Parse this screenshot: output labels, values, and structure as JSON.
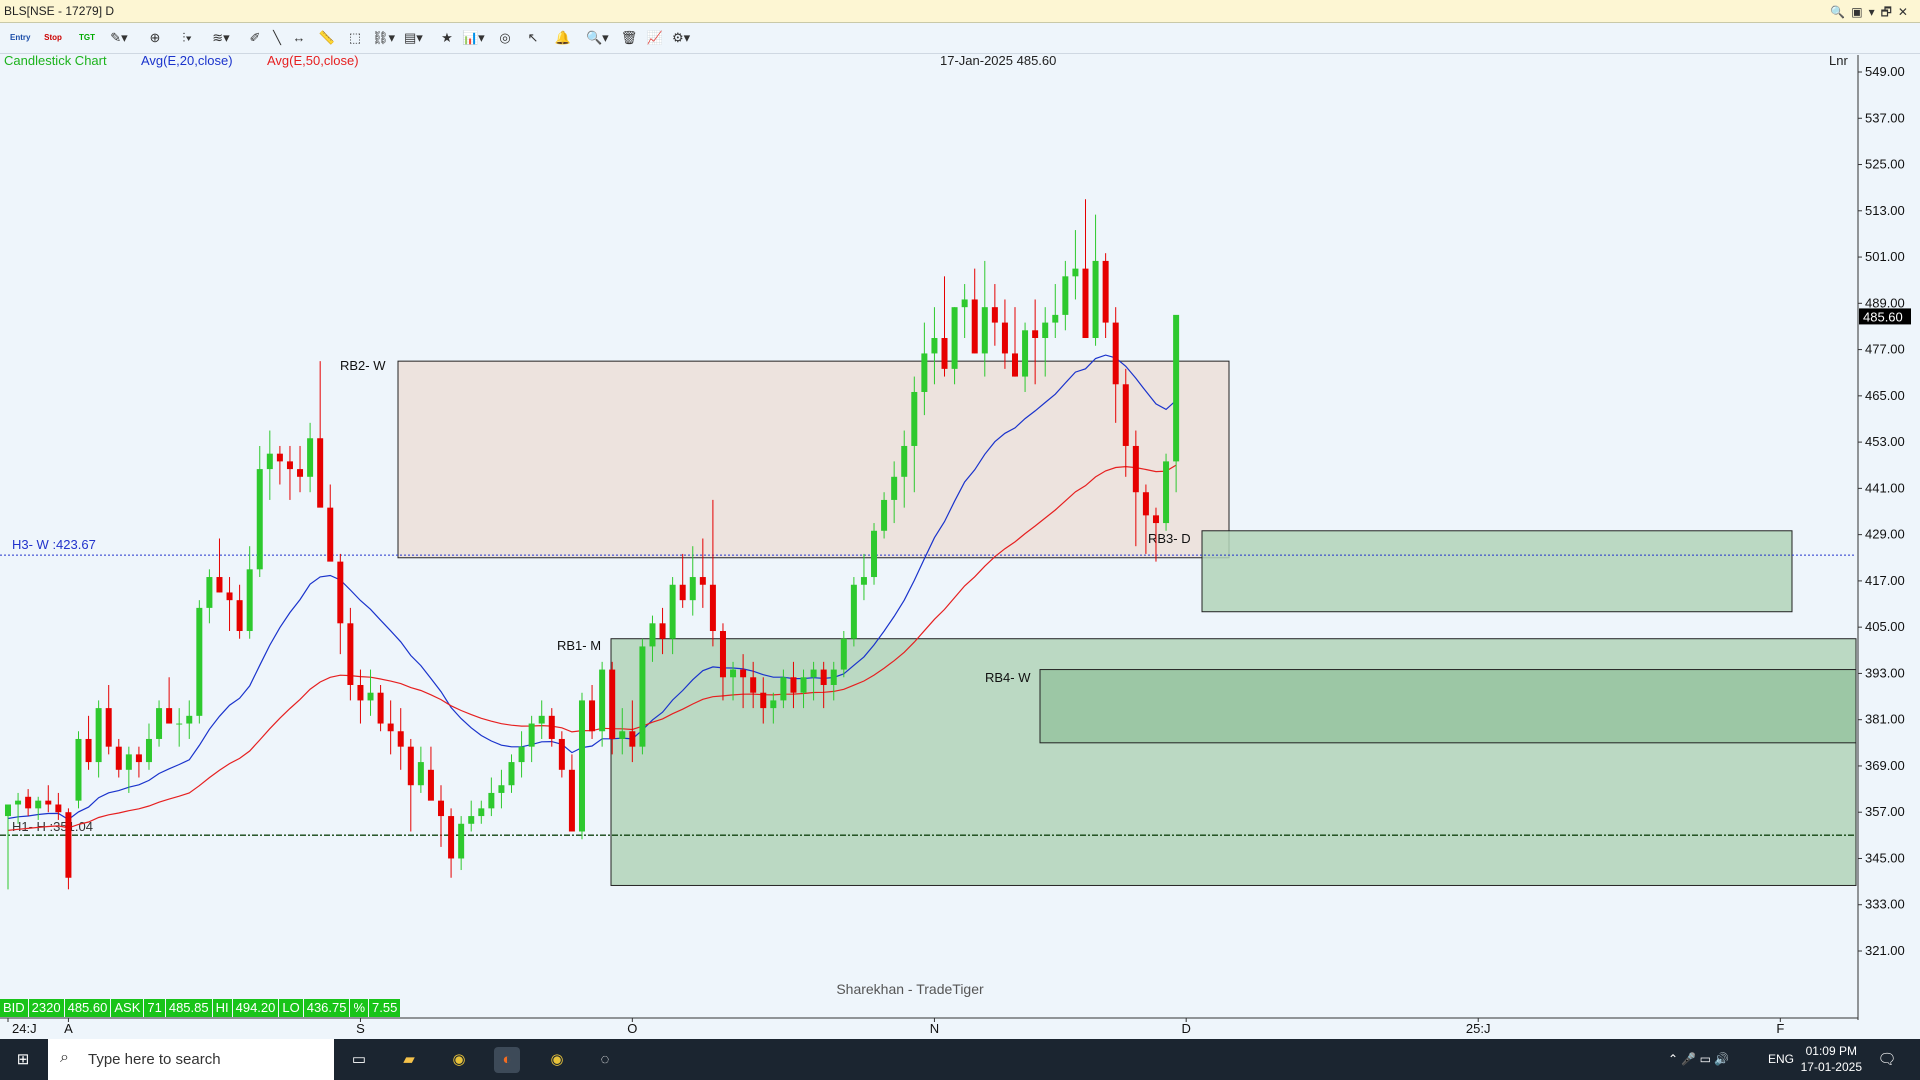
{
  "window": {
    "title": "BLS[NSE - 17279] D"
  },
  "toolbar": {
    "icons": [
      "entry-icon",
      "stop-icon",
      "target-icon",
      "draw-icon",
      "crosshair-icon",
      "line-tools-icon",
      "fib-icon",
      "pen-icon",
      "trendline-icon",
      "ray-icon",
      "ruler-icon",
      "box-icon",
      "link-icon",
      "template-icon",
      "favorite-icon",
      "indicator-icon",
      "scan-icon",
      "cursor-icon",
      "alert-icon",
      "zoom-icon",
      "delete-icon",
      "study-icon",
      "settings-icon"
    ],
    "entry_label": "Entry",
    "stop_label": "Stop",
    "tgt_label": "TGT"
  },
  "legend": {
    "chart_type": "Candlestick Chart",
    "avg20": "Avg(E,20,close)",
    "avg50": "Avg(E,50,close)",
    "center": "17-Jan-2025 485.60",
    "scale": "Lnr"
  },
  "colors": {
    "up": "#2ec92e",
    "down": "#e60000",
    "ema20": "#1a33cc",
    "ema50": "#e62020",
    "zone_red": "#ecdfd8",
    "zone_green": "#b2d3b8",
    "hline_blue": "#2233cc"
  },
  "chart_data": {
    "type": "candlestick",
    "ylim": [
      315,
      555
    ],
    "y_ticks": [
      "549.00",
      "537.00",
      "525.00",
      "513.00",
      "501.00",
      "489.00",
      "477.00",
      "465.00",
      "453.00",
      "441.00",
      "429.00",
      "417.00",
      "405.00",
      "393.00",
      "381.00",
      "369.00",
      "357.00",
      "345.00",
      "333.00",
      "321.00"
    ],
    "last_price_label": "485.60",
    "x_ticks": [
      {
        "label": "24:J",
        "i": 0
      },
      {
        "label": "A",
        "i": 6
      },
      {
        "label": "S",
        "i": 35
      },
      {
        "label": "O",
        "i": 62
      },
      {
        "label": "N",
        "i": 92
      },
      {
        "label": "D",
        "i": 117
      },
      {
        "label": "25:J",
        "i": 146
      },
      {
        "label": "F",
        "i": 176
      }
    ],
    "candles": [
      [
        356,
        359,
        337,
        359
      ],
      [
        359,
        362,
        354,
        360
      ],
      [
        361,
        363,
        356,
        358
      ],
      [
        358,
        361,
        355,
        360
      ],
      [
        360,
        364,
        357,
        359
      ],
      [
        359,
        362,
        355,
        357
      ],
      [
        357,
        358,
        337,
        340
      ],
      [
        360,
        378,
        358,
        376
      ],
      [
        376,
        382,
        368,
        370
      ],
      [
        370,
        386,
        366,
        384
      ],
      [
        384,
        390,
        372,
        374
      ],
      [
        374,
        376,
        366,
        368
      ],
      [
        368,
        374,
        362,
        372
      ],
      [
        372,
        374,
        366,
        370
      ],
      [
        370,
        380,
        368,
        376
      ],
      [
        376,
        386,
        374,
        384
      ],
      [
        384,
        392,
        380,
        380
      ],
      [
        380,
        384,
        374,
        380
      ],
      [
        380,
        386,
        376,
        382
      ],
      [
        382,
        412,
        380,
        410
      ],
      [
        410,
        420,
        406,
        418
      ],
      [
        418,
        428,
        414,
        414
      ],
      [
        414,
        418,
        404,
        412
      ],
      [
        412,
        416,
        402,
        404
      ],
      [
        404,
        426,
        402,
        420
      ],
      [
        420,
        452,
        418,
        446
      ],
      [
        446,
        456,
        438,
        450
      ],
      [
        450,
        452,
        442,
        448
      ],
      [
        448,
        452,
        438,
        446
      ],
      [
        446,
        452,
        440,
        444
      ],
      [
        444,
        458,
        440,
        454
      ],
      [
        454,
        474,
        446,
        436
      ],
      [
        436,
        442,
        424,
        422
      ],
      [
        422,
        424,
        398,
        406
      ],
      [
        406,
        410,
        386,
        390
      ],
      [
        390,
        394,
        380,
        386
      ],
      [
        386,
        394,
        382,
        388
      ],
      [
        388,
        390,
        378,
        380
      ],
      [
        380,
        386,
        372,
        378
      ],
      [
        378,
        384,
        368,
        374
      ],
      [
        374,
        376,
        352,
        364
      ],
      [
        364,
        374,
        362,
        370
      ],
      [
        368,
        374,
        366,
        360
      ],
      [
        360,
        364,
        348,
        356
      ],
      [
        356,
        358,
        340,
        345
      ],
      [
        345,
        356,
        342,
        354
      ],
      [
        354,
        360,
        352,
        356
      ],
      [
        356,
        360,
        354,
        358
      ],
      [
        358,
        366,
        356,
        362
      ],
      [
        362,
        368,
        358,
        364
      ],
      [
        364,
        372,
        362,
        370
      ],
      [
        370,
        378,
        366,
        374
      ],
      [
        374,
        382,
        370,
        380
      ],
      [
        380,
        386,
        376,
        382
      ],
      [
        382,
        384,
        374,
        376
      ],
      [
        376,
        378,
        366,
        368
      ],
      [
        368,
        372,
        354,
        352
      ],
      [
        352,
        388,
        350,
        386
      ],
      [
        386,
        390,
        376,
        378
      ],
      [
        378,
        396,
        374,
        394
      ],
      [
        394,
        396,
        372,
        376
      ],
      [
        376,
        384,
        372,
        378
      ],
      [
        378,
        386,
        370,
        374
      ],
      [
        374,
        402,
        372,
        400
      ],
      [
        400,
        408,
        396,
        406
      ],
      [
        406,
        410,
        398,
        402
      ],
      [
        402,
        418,
        398,
        416
      ],
      [
        416,
        424,
        410,
        412
      ],
      [
        412,
        426,
        408,
        418
      ],
      [
        418,
        428,
        410,
        416
      ],
      [
        416,
        438,
        400,
        404
      ],
      [
        404,
        406,
        386,
        392
      ],
      [
        392,
        396,
        386,
        394
      ],
      [
        394,
        398,
        384,
        392
      ],
      [
        392,
        396,
        384,
        388
      ],
      [
        388,
        392,
        380,
        384
      ],
      [
        384,
        388,
        380,
        386
      ],
      [
        386,
        394,
        384,
        392
      ],
      [
        392,
        396,
        384,
        388
      ],
      [
        388,
        394,
        384,
        392
      ],
      [
        392,
        396,
        386,
        394
      ],
      [
        394,
        396,
        384,
        390
      ],
      [
        390,
        396,
        386,
        394
      ],
      [
        394,
        404,
        392,
        402
      ],
      [
        402,
        418,
        400,
        416
      ],
      [
        416,
        424,
        412,
        418
      ],
      [
        418,
        432,
        416,
        430
      ],
      [
        430,
        440,
        428,
        438
      ],
      [
        438,
        448,
        432,
        444
      ],
      [
        444,
        456,
        436,
        452
      ],
      [
        452,
        470,
        440,
        466
      ],
      [
        466,
        484,
        460,
        476
      ],
      [
        476,
        488,
        468,
        480
      ],
      [
        480,
        496,
        470,
        472
      ],
      [
        472,
        488,
        468,
        488
      ],
      [
        488,
        494,
        480,
        490
      ],
      [
        490,
        498,
        476,
        476
      ],
      [
        476,
        500,
        470,
        488
      ],
      [
        488,
        494,
        478,
        484
      ],
      [
        484,
        490,
        472,
        476
      ],
      [
        476,
        488,
        470,
        470
      ],
      [
        470,
        484,
        466,
        482
      ],
      [
        482,
        490,
        468,
        480
      ],
      [
        480,
        488,
        470,
        484
      ],
      [
        484,
        494,
        480,
        486
      ],
      [
        486,
        500,
        482,
        496
      ],
      [
        496,
        508,
        490,
        498
      ],
      [
        498,
        516,
        494,
        480
      ],
      [
        480,
        512,
        478,
        500
      ],
      [
        500,
        502,
        480,
        484
      ],
      [
        484,
        488,
        458,
        468
      ],
      [
        468,
        472,
        444,
        452
      ],
      [
        452,
        456,
        426,
        440
      ],
      [
        440,
        442,
        424,
        434
      ],
      [
        434,
        436,
        422,
        432
      ],
      [
        432,
        450,
        430,
        448
      ],
      [
        448,
        476,
        440,
        486
      ]
    ]
  },
  "zones": [
    {
      "label": "RB2- W"
    },
    {
      "label": "RB1- M"
    },
    {
      "label": "RB4- W"
    },
    {
      "label": "RB3- D"
    }
  ],
  "hlines": [
    {
      "label": "H3- W :423.67"
    },
    {
      "label": "H1- H :351.04"
    }
  ],
  "watermark": "Sharekhan - TradeTiger",
  "bidbar": [
    {
      "label": "BID",
      "value": "2320",
      "value2": "485.60"
    },
    {
      "label": "ASK",
      "value": "71",
      "value2": "485.85"
    },
    {
      "label": "HI",
      "value": "494.20"
    },
    {
      "label": "LO",
      "value": "436.75"
    },
    {
      "label": "%",
      "value": "7.55"
    }
  ],
  "taskbar": {
    "search_placeholder": "Type here to search",
    "lang": "ENG",
    "time": "01:09 PM",
    "date": "17-01-2025"
  }
}
